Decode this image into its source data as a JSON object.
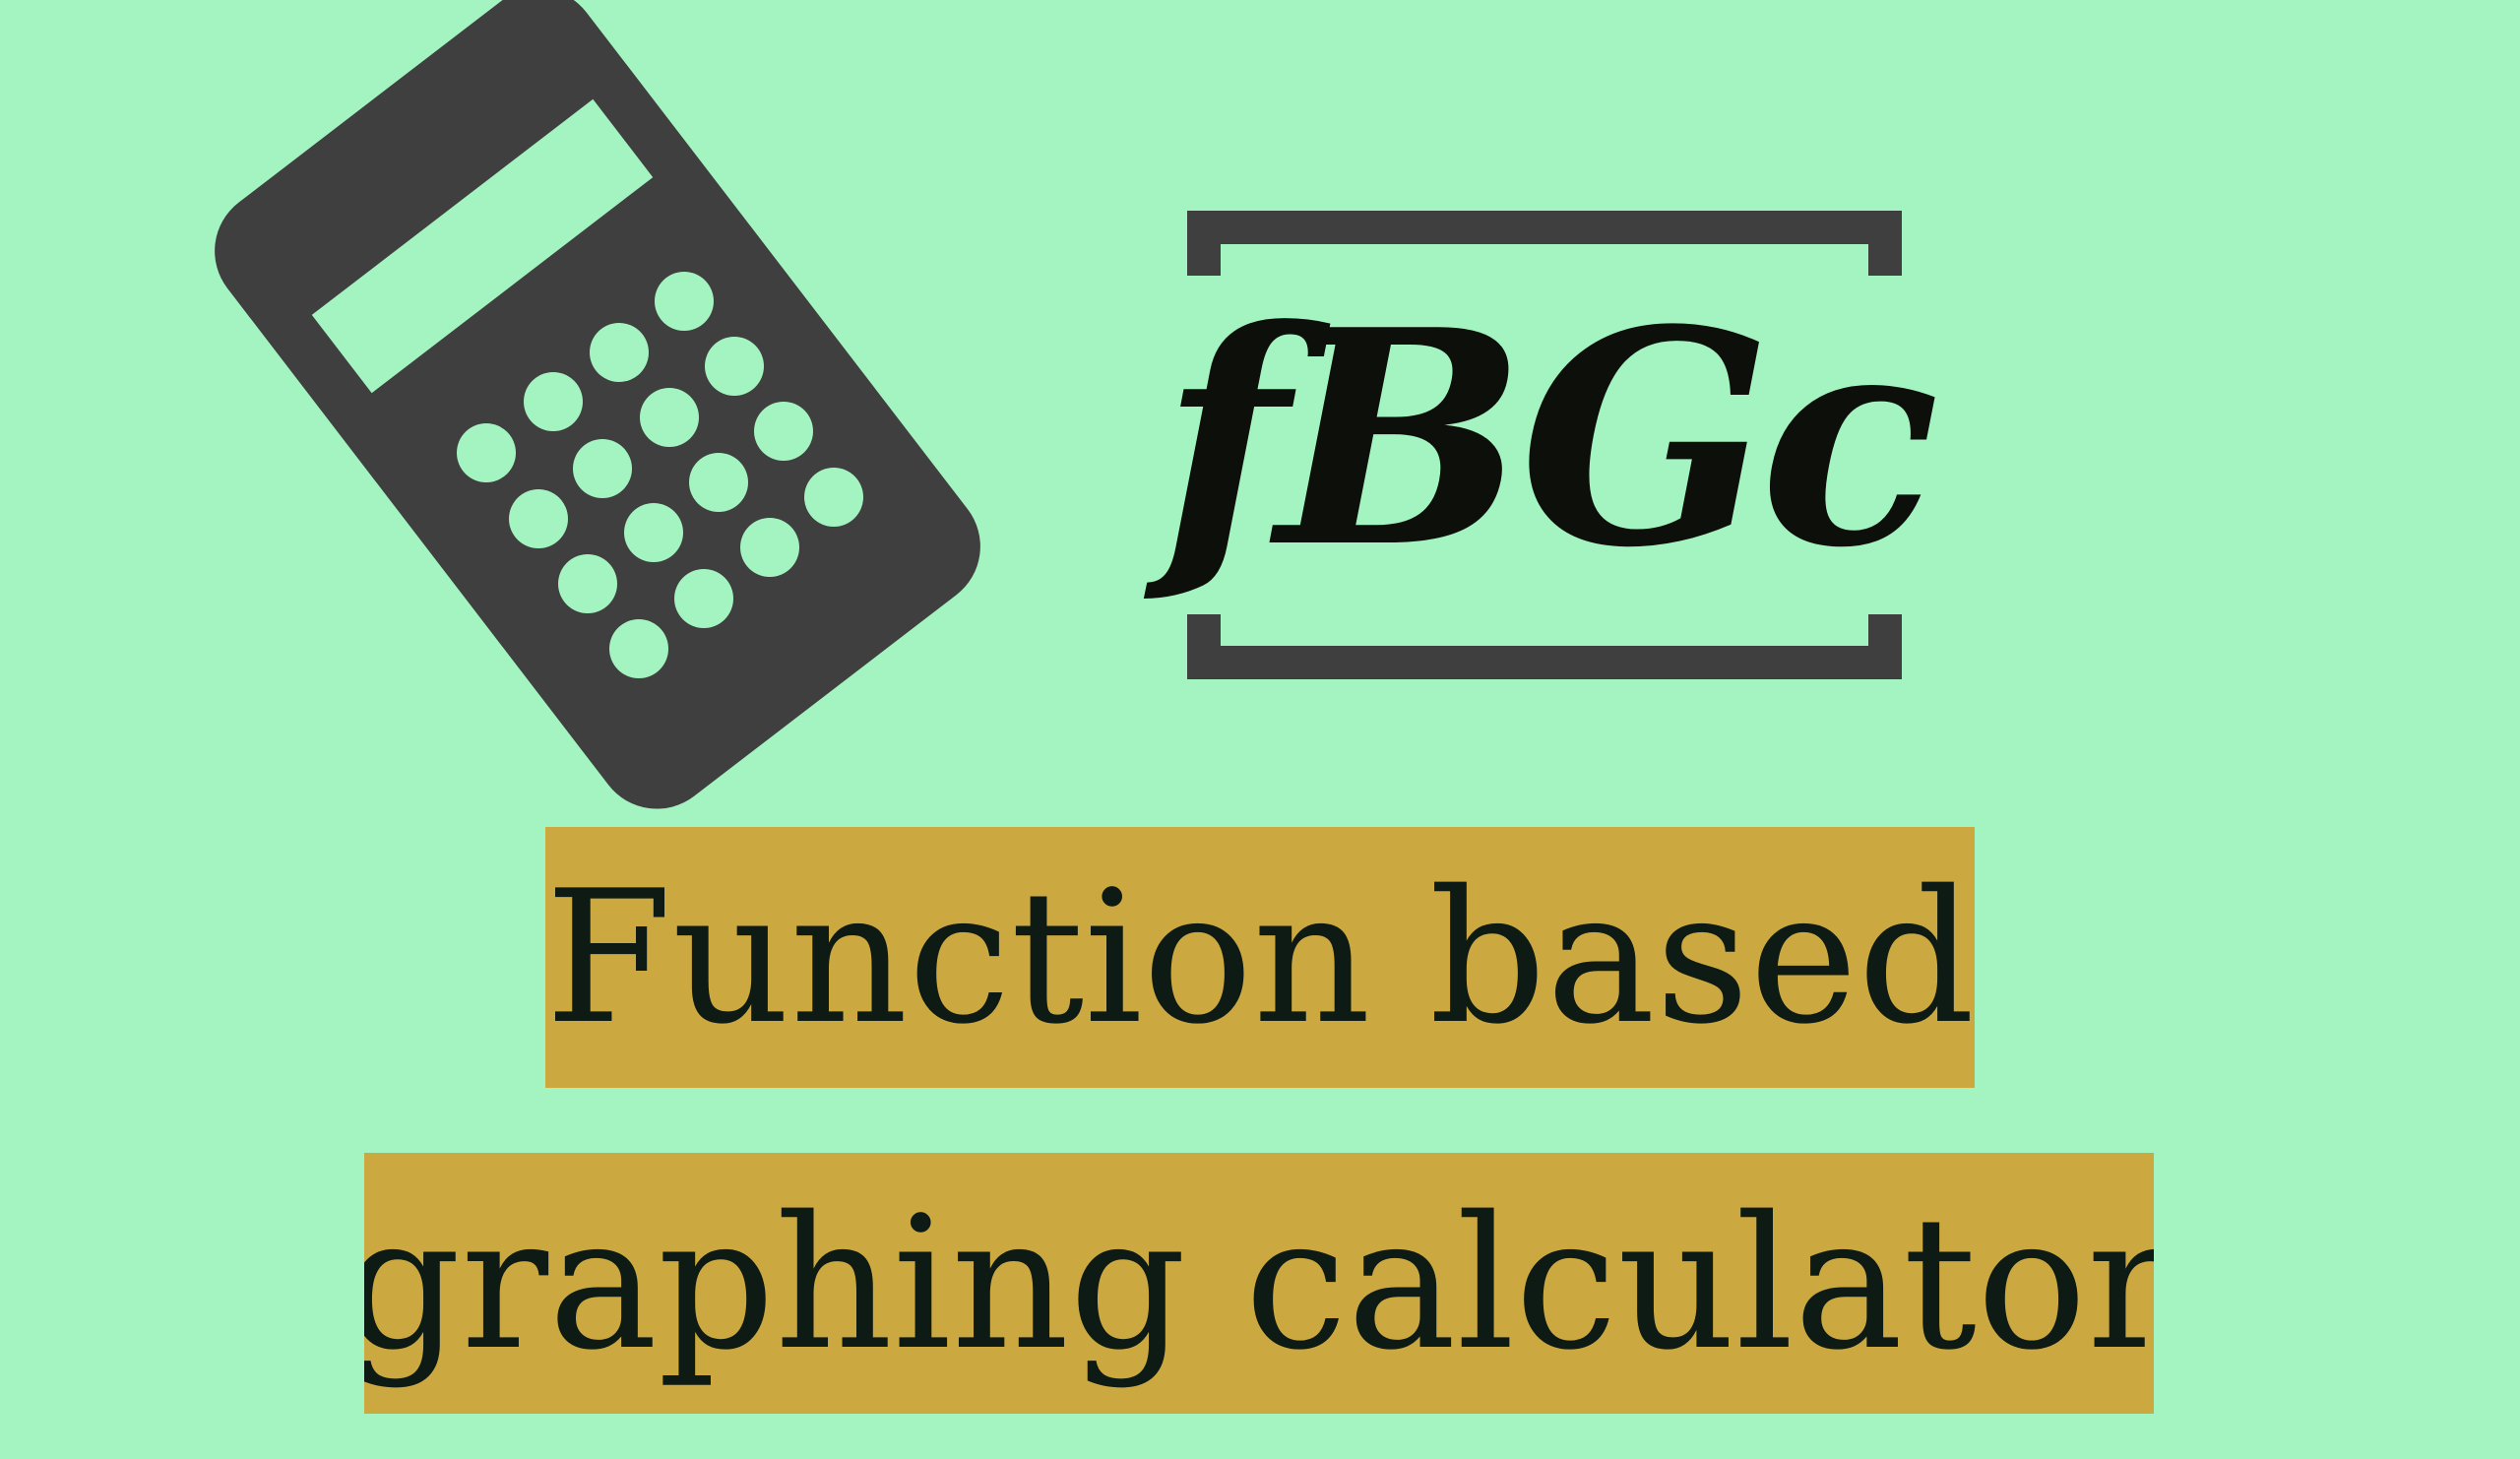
{
  "colors": {
    "background": "#a3f4c0",
    "icon_gray": "#3f3f3f",
    "banner_gold": "#cca940",
    "text_dark": "#0e1a14"
  },
  "logo": {
    "text": "fBGc"
  },
  "title": {
    "line1": "Function based",
    "line2": "graphing calculator"
  },
  "icons": {
    "calculator": "calculator-icon",
    "bracket": "bracket-frame-icon"
  }
}
